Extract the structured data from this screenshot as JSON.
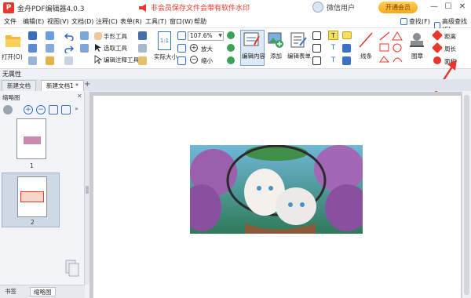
{
  "title_bar": {
    "app_title": "金舟PDF编辑器4.0.3",
    "promo_text": "非会员保存文件会带有软件水印",
    "user_label": "微信用户",
    "vip_button": "开通会员",
    "minimize": "—",
    "maximize": "☐",
    "close": "✕"
  },
  "menu": {
    "items": [
      "文件",
      "编辑(E)",
      "视图(V)",
      "文档(D)",
      "注释(C)",
      "表单(R)",
      "工具(T)",
      "窗口(W)",
      "帮助"
    ],
    "find": "查找(F)",
    "advanced_find": "高级查找(S)"
  },
  "ribbon": {
    "open": "打开(O)",
    "hand_tool": "手形工具",
    "select_tool": "选取工具",
    "edit_annotation_tool": "编辑注释工具",
    "actual_size": "实际大小",
    "zoom_value": "107.6%",
    "zoom_in": "放大",
    "zoom_out": "缩小",
    "edit_content": "编辑内容",
    "add": "添加",
    "edit_form": "编辑表单",
    "line": "线条",
    "stamp": "图章",
    "distance": "距离",
    "perimeter": "周长",
    "area": "面积"
  },
  "status": {
    "no_effect": "无属性"
  },
  "doc_tabs": {
    "tab1": "新建文档",
    "tab2": "新建文档1 *",
    "add": "+"
  },
  "sidebar": {
    "title": "缩略图",
    "close": "✕",
    "pages": [
      {
        "num": "1"
      },
      {
        "num": "2"
      }
    ],
    "bottom_tabs": [
      "书签",
      "缩略图"
    ]
  },
  "colors": {
    "accent_red": "#e8372c",
    "selection_blue": "#dde9f7",
    "vip_gold": "#f3a71c"
  }
}
